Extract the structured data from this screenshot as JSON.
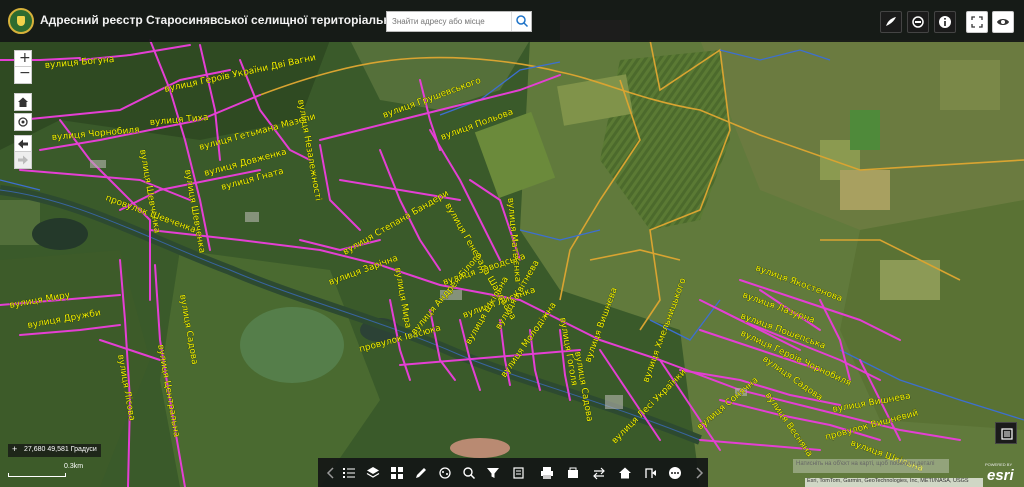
{
  "app": {
    "title": "Адресний реєстр Старосинявської селищної територіальної громади"
  },
  "search": {
    "placeholder": "Знайти адресу або місце"
  },
  "header_tools": [
    "layer-list-icon",
    "basemap-gallery-icon",
    "info-icon",
    "fullscreen-icon",
    "visibility-icon"
  ],
  "map_tools": {
    "zoom_in": "+",
    "zoom_out": "−",
    "home": "home-icon",
    "locate": "locate-icon",
    "back": "back-arrow-icon",
    "forward": "forward-arrow-icon"
  },
  "coordinates": {
    "readout": "27,680 49,581 Градуси"
  },
  "scale": {
    "label": "0.3km"
  },
  "streets": [
    "вулиця Богуна",
    "вулиця Героїв України Дві Вагни",
    "вулиця Чорнобиля",
    "вулиця Тиха",
    "вулиця Шевченка",
    "вулиця Грушевського",
    "вулиця Польова",
    "вулиця Гетьмана Мазепи",
    "вулиця Довженка",
    "вулиця Гната",
    "вулиця Шевченка",
    "вулиця Незалежності",
    "провулок Шевченка",
    "вулиця Степана Бандери",
    "вулиця Генерала Шаповала",
    "вулиця Матвієнка",
    "вулиця Заводська",
    "вулиця Зарічна",
    "вулиця Мира",
    "вулиця Дружби",
    "вулиця Садова",
    "вулиця Миру",
    "вулиця Центральна",
    "вулиця Лісова",
    "провулок Івасюка",
    "вулиця Андрея Білого",
    "вулиця Лисенка",
    "вулиця Шкільна",
    "вулиця Квітнева",
    "вулиця Молодіжна",
    "вулиця Гоголя",
    "вулиця Вишнева",
    "вулиця Садова",
    "вулиця Хмельницького",
    "вулиця Сонячна",
    "вулиця Лесі Українки",
    "вулиця Якостенова",
    "вулиця Лазурна",
    "вулиця Пошепська",
    "вулиця Героїв Чорнобиля",
    "вулиця Садова",
    "вулиця Вишнева",
    "вулиця Весняна",
    "провулок Вишневий",
    "вулиця Шкільна"
  ],
  "bottom_toolbar": [
    "prev-arrow-icon",
    "list-icon",
    "layers-icon",
    "grid-icon",
    "draw-icon",
    "measure-icon",
    "zoom-to-icon",
    "filter-icon",
    "edit-icon",
    "print-icon",
    "bookmark-icon",
    "swap-icon",
    "home-icon",
    "share-icon",
    "more-icon",
    "next-arrow-icon"
  ],
  "popup_hint": "Натисніть на об'єкт на карті, щоб побачити деталі",
  "attribution": "Esri, TomTom, Garmin, GeoTechnologies, Inc, METI/NASA, USGS",
  "esri": {
    "powered": "POWERED BY",
    "word": "esri"
  },
  "colors": {
    "road": "#e43fd4",
    "boundary_orange": "#d9a431",
    "boundary_blue": "#3d6fd0",
    "label": "#f5f500"
  }
}
